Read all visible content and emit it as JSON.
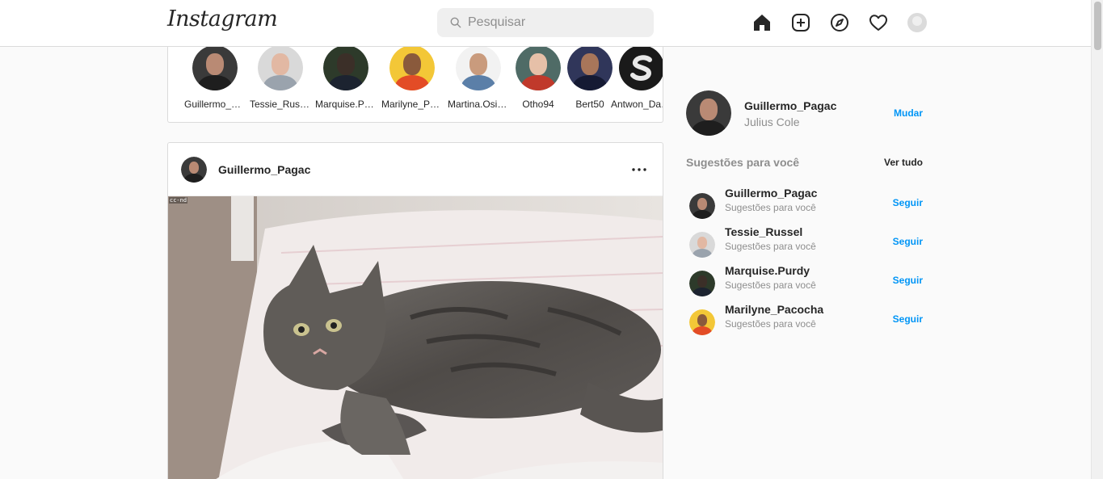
{
  "header": {
    "logo": "Instagram",
    "search_placeholder": "Pesquisar",
    "icons": [
      "home-icon",
      "new-post-icon",
      "explore-icon",
      "activity-heart-icon",
      "profile-avatar"
    ]
  },
  "stories": [
    {
      "username": "Guillermo_Pagac"
    },
    {
      "username": "Tessie_Russel"
    },
    {
      "username": "Marquise.Purdy"
    },
    {
      "username": "Marilyne_Pacocha"
    },
    {
      "username": "Martina.Osinski"
    },
    {
      "username": "Otho94"
    },
    {
      "username": "Bert50"
    },
    {
      "username": "Antwon_Daniel"
    }
  ],
  "post": {
    "username": "Guillermo_Pagac",
    "image_watermark": "cc-nd",
    "image_subject": "tabby kitten lying on a blanket"
  },
  "sidebar": {
    "current_user": {
      "username": "Guillermo_Pagac",
      "full_name": "Julius Cole",
      "switch_label": "Mudar"
    },
    "suggestions_title": "Sugestões para você",
    "see_all_label": "Ver tudo",
    "suggestions": [
      {
        "username": "Guillermo_Pagac",
        "subtitle": "Sugestões para você",
        "follow_label": "Seguir"
      },
      {
        "username": "Tessie_Russel",
        "subtitle": "Sugestões para você",
        "follow_label": "Seguir"
      },
      {
        "username": "Marquise.Purdy",
        "subtitle": "Sugestões para você",
        "follow_label": "Seguir"
      },
      {
        "username": "Marilyne_Pacocha",
        "subtitle": "Sugestões para você",
        "follow_label": "Seguir"
      }
    ]
  },
  "colors": {
    "link_blue": "#0095f6",
    "text": "#262626",
    "muted": "#8e8e8e",
    "border": "#dbdbdb",
    "background": "#fafafa"
  }
}
